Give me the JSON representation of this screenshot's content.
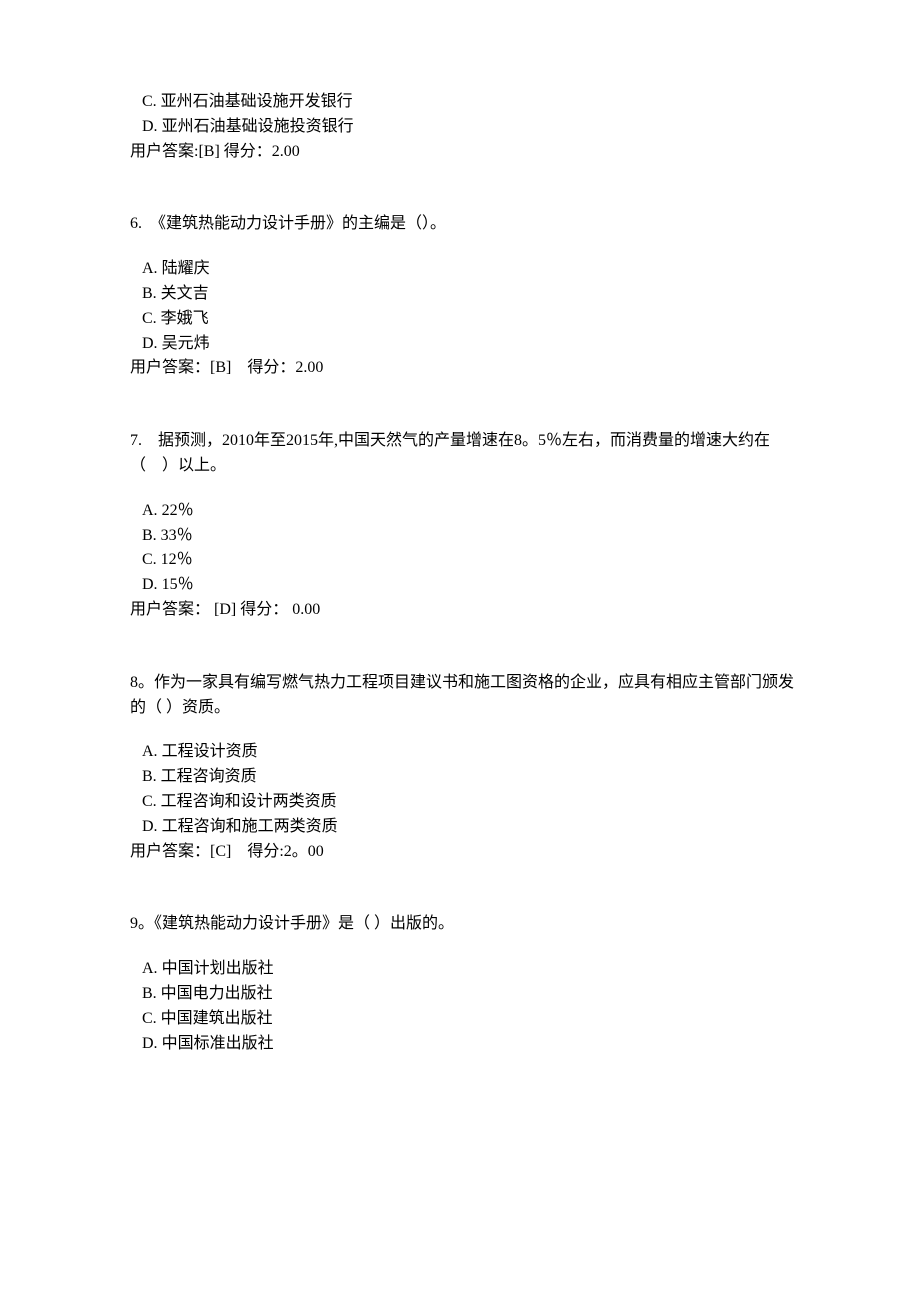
{
  "q5_tail": {
    "options": [
      {
        "label": "C.",
        "text": "亚州石油基础设施开发银行"
      },
      {
        "label": "D.",
        "text": "亚州石油基础设施投资银行"
      }
    ],
    "answer": "用户答案:[B] 得分：2.00"
  },
  "q6": {
    "stem": "6.　《建筑热能动力设计手册》的主编是（）。",
    "options": [
      {
        "label": "A.",
        "text": "陆耀庆"
      },
      {
        "label": "B.",
        "text": "关文吉"
      },
      {
        "label": "C.",
        "text": "李娥飞"
      },
      {
        "label": "D.",
        "text": "吴元炜"
      }
    ],
    "answer": "用户答案：[B]　得分：2.00"
  },
  "q7": {
    "stem": "7.　据预测，2010年至2015年,中国天然气的产量增速在8。5％左右，而消费量的增速大约在（　）以上。",
    "options": [
      {
        "label": "A.",
        "text": "22％"
      },
      {
        "label": "B.",
        "text": "33％"
      },
      {
        "label": "C.",
        "text": "12％"
      },
      {
        "label": "D.",
        "text": "15％"
      }
    ],
    "answer": "用户答案：  [D] 得分：  0.00"
  },
  "q8": {
    "stem": "8。作为一家具有编写燃气热力工程项目建议书和施工图资格的企业，应具有相应主管部门颁发的（  ）资质。",
    "options": [
      {
        "label": "A.",
        "text": "工程设计资质"
      },
      {
        "label": "B.",
        "text": "工程咨询资质"
      },
      {
        "label": "C.",
        "text": "工程咨询和设计两类资质"
      },
      {
        "label": "D.",
        "text": "工程咨询和施工两类资质"
      }
    ],
    "answer": "用户答案：[C]　得分:2。00"
  },
  "q9": {
    "stem": "9。《建筑热能动力设计手册》是（  ）出版的。",
    "options": [
      {
        "label": "A.",
        "text": "中国计划出版社"
      },
      {
        "label": "B.",
        "text": "中国电力出版社"
      },
      {
        "label": "C.",
        "text": "中国建筑出版社"
      },
      {
        "label": "D.",
        "text": "中国标准出版社"
      }
    ]
  }
}
